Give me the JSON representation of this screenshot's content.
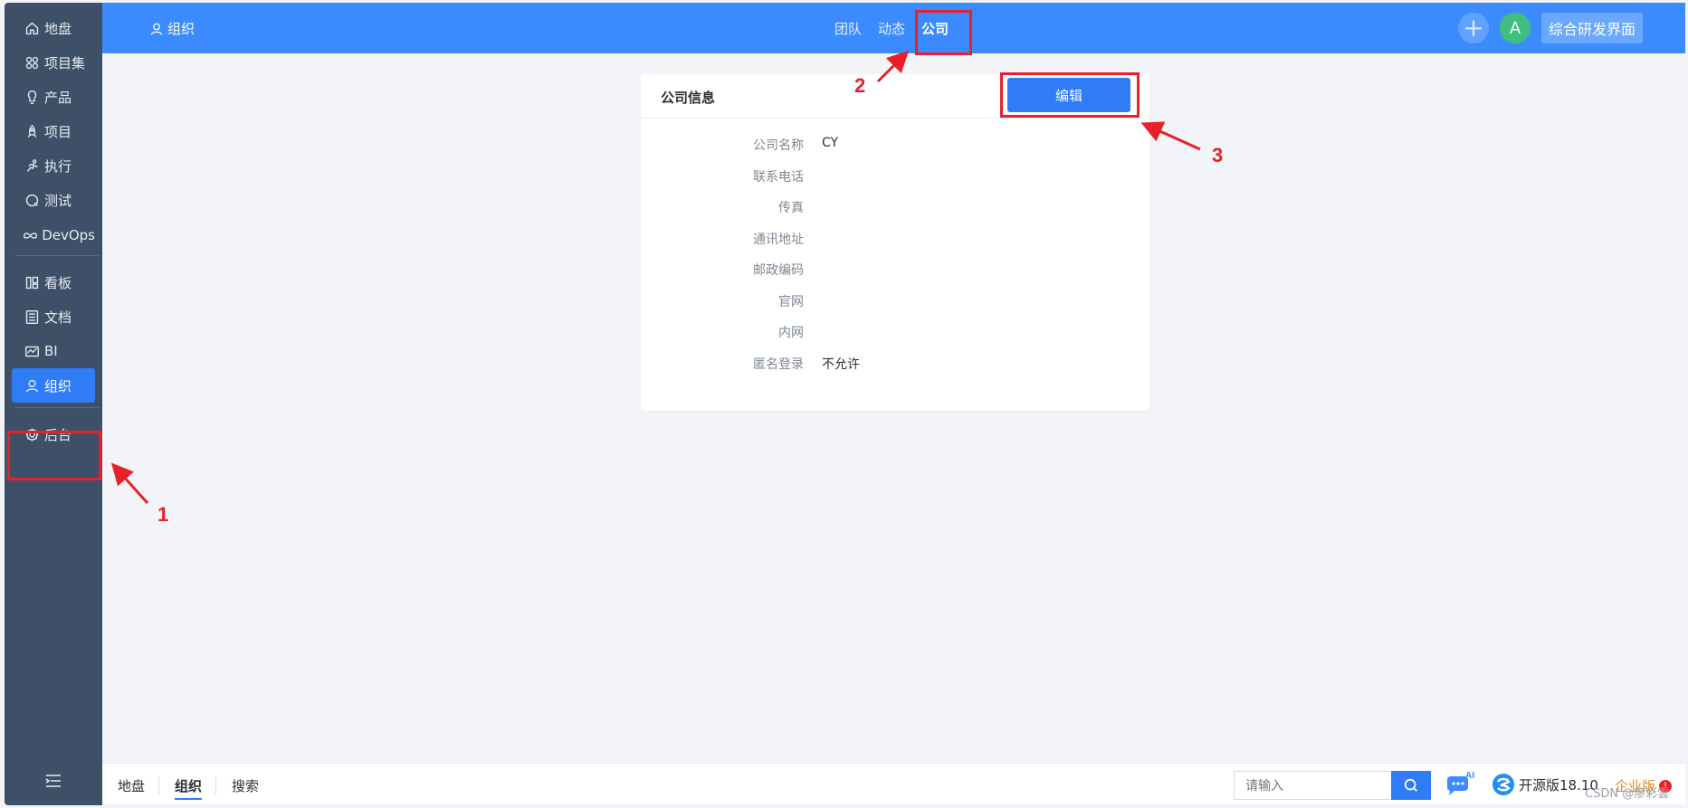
{
  "sidebar": {
    "items": [
      {
        "label": "地盘",
        "icon": "home-icon"
      },
      {
        "label": "项目集",
        "icon": "grid-icon"
      },
      {
        "label": "产品",
        "icon": "bulb-icon"
      },
      {
        "label": "项目",
        "icon": "rocket-icon"
      },
      {
        "label": "执行",
        "icon": "run-icon"
      },
      {
        "label": "测试",
        "icon": "test-icon"
      },
      {
        "label": "DevOps",
        "icon": "infinity-icon"
      },
      {
        "label": "看板",
        "icon": "kanban-icon"
      },
      {
        "label": "文档",
        "icon": "doc-icon"
      },
      {
        "label": "BI",
        "icon": "chart-icon"
      },
      {
        "label": "组织",
        "icon": "user-icon"
      },
      {
        "label": "后台",
        "icon": "gear-icon"
      }
    ],
    "active": "组织"
  },
  "header": {
    "section": "组织",
    "tabs": [
      {
        "label": "团队"
      },
      {
        "label": "动态"
      },
      {
        "label": "公司"
      }
    ],
    "active_tab": "公司",
    "plus_label": "+",
    "avatar": "A",
    "project_label": "综合研发界面"
  },
  "card": {
    "title": "公司信息",
    "edit_label": "编辑",
    "fields": [
      {
        "label": "公司名称",
        "value": "CY"
      },
      {
        "label": "联系电话",
        "value": ""
      },
      {
        "label": "传真",
        "value": ""
      },
      {
        "label": "通讯地址",
        "value": ""
      },
      {
        "label": "邮政编码",
        "value": ""
      },
      {
        "label": "官网",
        "value": ""
      },
      {
        "label": "内网",
        "value": ""
      },
      {
        "label": "匿名登录",
        "value": "不允许"
      }
    ]
  },
  "footer": {
    "crumbs": [
      {
        "label": "地盘"
      },
      {
        "label": "组织"
      },
      {
        "label": "搜索"
      }
    ],
    "active_crumb": "组织",
    "search_placeholder": "请输入",
    "ai_label": "AI",
    "version": "开源版18.10",
    "enterprise": "企业版",
    "enterprise_badge": "!"
  },
  "annotations": {
    "n1": "1",
    "n2": "2",
    "n3": "3"
  },
  "watermark": "CSDN @廖彩雲",
  "colors": {
    "sidebar_bg": "#3d5068",
    "header_bg": "#3b8bff",
    "primary": "#2f7cf6",
    "annotation_red": "#e8202a"
  }
}
